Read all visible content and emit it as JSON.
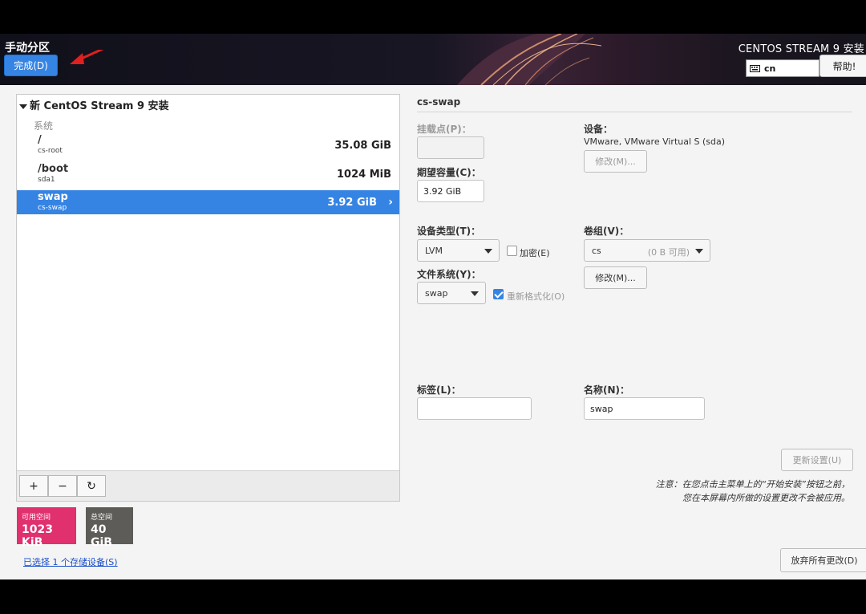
{
  "header": {
    "title": "手动分区",
    "done_label": "完成(D)",
    "product_title": "CENTOS STREAM 9 安装",
    "keyboard_layout": "cn",
    "help_label": "帮助!"
  },
  "tree": {
    "root_label": "新 CentOS Stream 9 安装",
    "group_label": "系统",
    "rows": [
      {
        "mount": "/",
        "device": "cs-root",
        "size": "35.08 GiB"
      },
      {
        "mount": "/boot",
        "device": "sda1",
        "size": "1024 MiB"
      },
      {
        "mount": "swap",
        "device": "cs-swap",
        "size": "3.92 GiB",
        "selected": true
      }
    ]
  },
  "toolbar": {
    "add": "+",
    "remove": "−",
    "refresh": "↻"
  },
  "space": {
    "available_label": "可用空间",
    "available_value": "1023 KiB",
    "available_color": "#e0306e",
    "total_label": "总空间",
    "total_value": "40 GiB",
    "total_color": "#5e5c58"
  },
  "storage_link": "已选择 1 个存储设备(S)",
  "detail": {
    "title": "cs-swap",
    "mount_label": "挂载点(P)：",
    "mount_value": "",
    "capacity_label": "期望容量(C)：",
    "capacity_value": "3.92 GiB",
    "device_label": "设备：",
    "device_value": "VMware, VMware Virtual S (sda)",
    "device_modify": "修改(M)...",
    "device_type_label": "设备类型(T)：",
    "device_type_value": "LVM",
    "encrypt_label": "加密(E)",
    "filesystem_label": "文件系统(Y)：",
    "filesystem_value": "swap",
    "reformat_label": "重新格式化(O)",
    "vg_label": "卷组(V)：",
    "vg_value": "cs",
    "vg_free": "(0 B 可用)",
    "vg_modify": "修改(M)...",
    "tag_label": "标签(L)：",
    "tag_value": "",
    "name_label": "名称(N)：",
    "name_value": "swap",
    "update_label": "更新设置(U)",
    "note_line1": "注意：在您点击主菜单上的“开始安装”按钮之前，",
    "note_line2": "您在本屏幕内所做的设置更改不会被应用。",
    "discard_label": "放弃所有更改(D)"
  }
}
